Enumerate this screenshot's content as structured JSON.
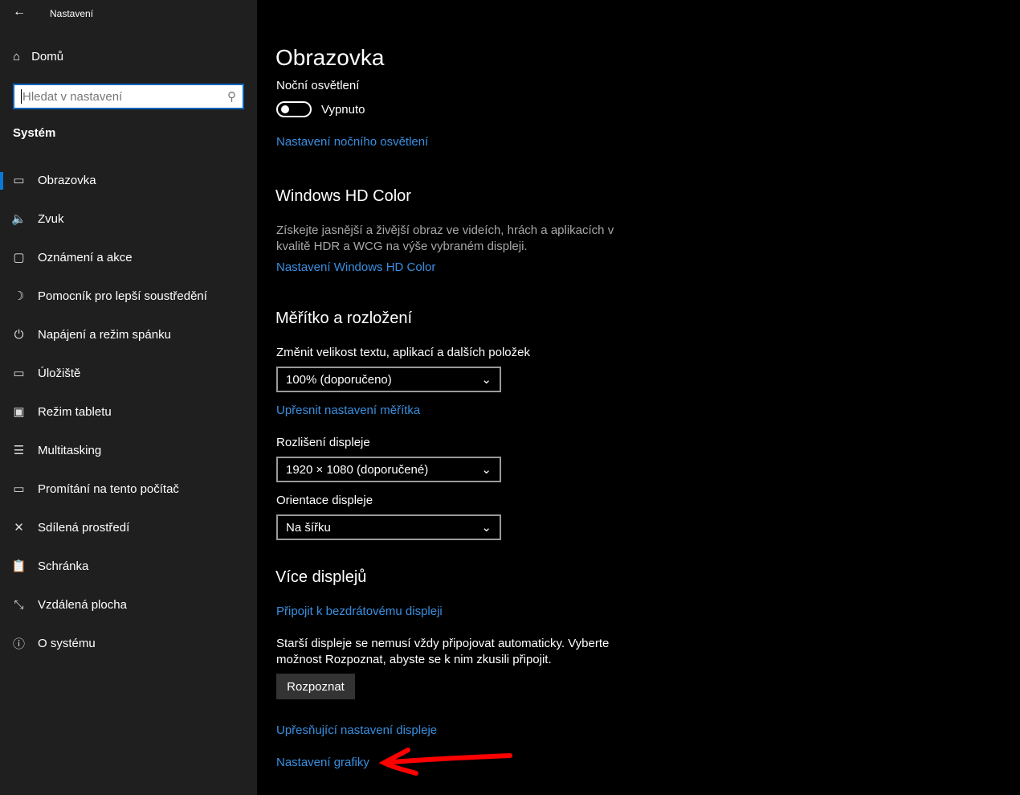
{
  "app": {
    "title": "Nastavení",
    "back_icon": "back-arrow-icon"
  },
  "sidebar": {
    "home": "Domů",
    "search_placeholder": "Hledat v nastavení",
    "section": "Systém",
    "items": [
      {
        "label": "Obrazovka",
        "icon": "▭"
      },
      {
        "label": "Zvuk",
        "icon": "🔈"
      },
      {
        "label": "Oznámení a akce",
        "icon": "▢"
      },
      {
        "label": "Pomocník pro lepší soustředění",
        "icon": "☽"
      },
      {
        "label": "Napájení a režim spánku",
        "icon": "⏻"
      },
      {
        "label": "Úložiště",
        "icon": "▭"
      },
      {
        "label": "Režim tabletu",
        "icon": "▣"
      },
      {
        "label": "Multitasking",
        "icon": "☰"
      },
      {
        "label": "Promítání na tento počítač",
        "icon": "▭"
      },
      {
        "label": "Sdílená prostředí",
        "icon": "✕"
      },
      {
        "label": "Schránka",
        "icon": "📋"
      },
      {
        "label": "Vzdálená plocha",
        "icon": "⤡"
      },
      {
        "label": "O systému",
        "icon": "ⓘ"
      }
    ]
  },
  "main": {
    "title": "Obrazovka",
    "night_label": "Noční osvětlení",
    "night_state": "Vypnuto",
    "night_link": "Nastavení nočního osvětlení",
    "hd_title": "Windows HD Color",
    "hd_desc1": "Získejte jasnější a živější obraz ve videích, hrách a aplikacích v",
    "hd_desc2": "kvalitě HDR a WCG na výše vybraném displeji.",
    "hd_link": "Nastavení Windows HD Color",
    "scale_title": "Měřítko a rozložení",
    "scale_label": "Změnit velikost textu, aplikací a dalších položek",
    "scale_value": "100% (doporučeno)",
    "scale_link": "Upřesnit nastavení měřítka",
    "res_label": "Rozlišení displeje",
    "res_value": "1920 × 1080 (doporučené)",
    "orient_label": "Orientace displeje",
    "orient_value": "Na šířku",
    "multi_title": "Více displejů",
    "wireless_link": "Připojit k bezdrátovému displeji",
    "multi_desc1": "Starší displeje se nemusí vždy připojovat automaticky. Vyberte",
    "multi_desc2": "možnost Rozpoznat, abyste se k nim zkusili připojit.",
    "detect_button": "Rozpoznat",
    "advanced_link": "Upřesňující nastavení displeje",
    "graphics_link": "Nastavení grafiky"
  },
  "colors": {
    "accent": "#0a78d7",
    "link": "#3a8fe0",
    "annotation": "#ff0000"
  }
}
